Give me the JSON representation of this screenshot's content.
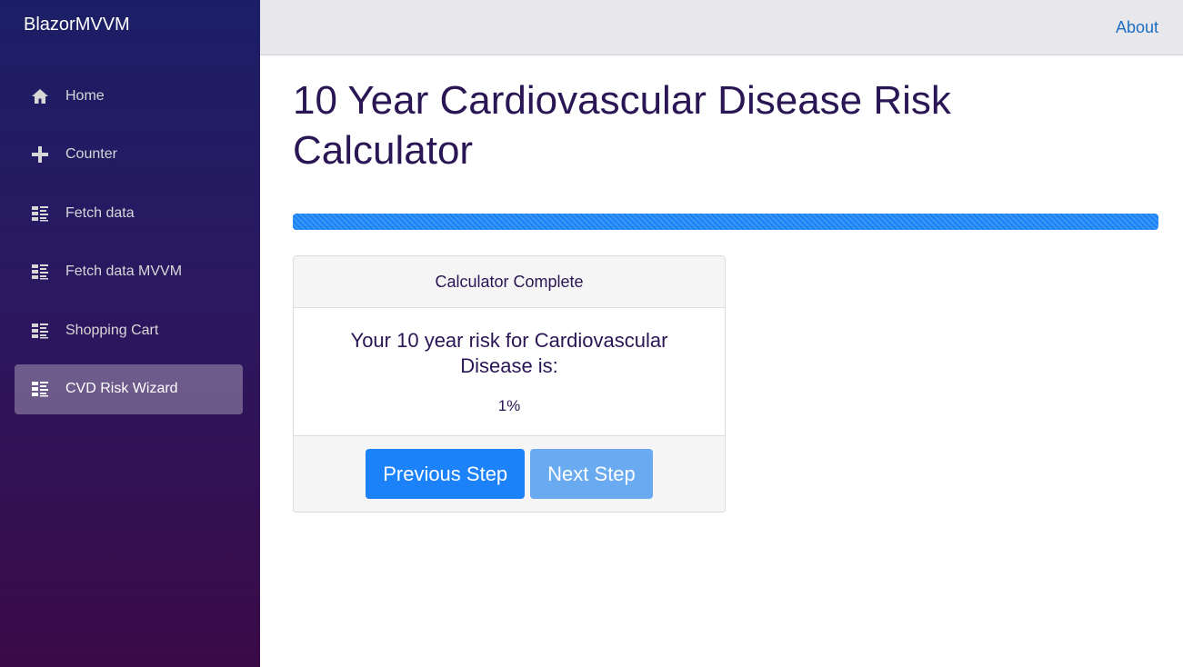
{
  "sidebar": {
    "brand": "BlazorMVVM",
    "items": [
      {
        "label": "Home",
        "icon": "home-icon"
      },
      {
        "label": "Counter",
        "icon": "plus-icon"
      },
      {
        "label": "Fetch data",
        "icon": "list-icon"
      },
      {
        "label": "Fetch data MVVM",
        "icon": "list-icon"
      },
      {
        "label": "Shopping Cart",
        "icon": "list-icon"
      },
      {
        "label": "CVD Risk Wizard",
        "icon": "list-icon",
        "active": true
      }
    ]
  },
  "header": {
    "about_label": "About"
  },
  "main": {
    "title": "10 Year Cardiovascular Disease Risk Calculator",
    "progress_percent": 100,
    "card": {
      "header": "Calculator Complete",
      "risk_heading": "Your 10 year risk for Cardiovascular Disease is:",
      "risk_value": "1%",
      "prev_label": "Previous Step",
      "next_label": "Next Step"
    }
  },
  "colors": {
    "accent": "#1b82fa",
    "link": "#1b6ec2",
    "title": "#2a1654"
  }
}
